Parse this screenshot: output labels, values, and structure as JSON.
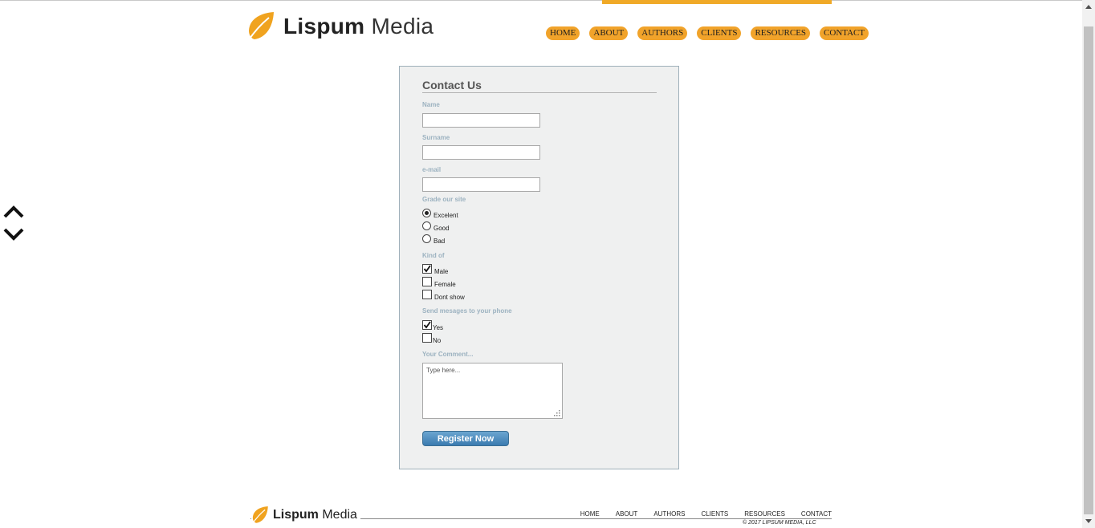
{
  "brand": {
    "name_bold": "Lispum",
    "name_light": "Media",
    "accent_color": "#f1a32a"
  },
  "nav": [
    "HOME",
    "ABOUT",
    "AUTHORS",
    "CLIENTS",
    "RESOURCES",
    "CONTACT"
  ],
  "form": {
    "title": "Contact Us",
    "name_label": "Name",
    "surname_label": "Surname",
    "email_label": "e-mail",
    "name_value": "",
    "surname_value": "",
    "email_value": "",
    "grade": {
      "label": "Grade our site",
      "options": [
        "Excelent",
        "Good",
        "Bad"
      ],
      "selected": "Excelent"
    },
    "kind": {
      "label": "Kind of",
      "options": [
        "Male",
        "Female",
        "Dont show"
      ],
      "checked": [
        "Male"
      ]
    },
    "phone": {
      "label": "Send mesages to your phone",
      "options": [
        "Yes",
        "No"
      ],
      "checked": [
        "Yes"
      ]
    },
    "comment": {
      "label": "Your Comment...",
      "placeholder": "Type here..."
    },
    "submit_label": "Register Now",
    "button_color": "#4a8cc0"
  },
  "footer": {
    "nav": [
      "HOME",
      "ABOUT",
      "AUTHORS",
      "CLIENTS",
      "RESOURCES",
      "CONTACT"
    ],
    "copyright": "© 2017 LIPSUM MEDIA, LLC"
  },
  "icons": {
    "logo": "leaf-icon",
    "side_up": "chevron-up-icon",
    "side_down": "chevron-down-icon"
  }
}
